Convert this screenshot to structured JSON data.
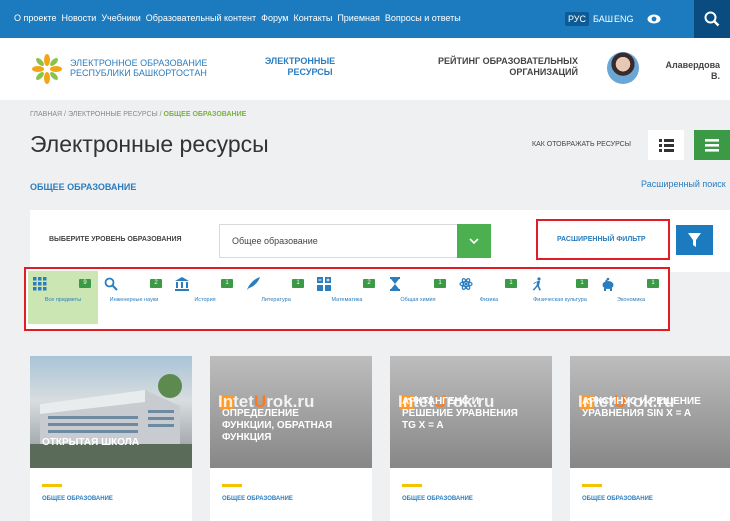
{
  "topnav": {
    "links": [
      "О проекте",
      "Новости",
      "Учебники",
      "Образовательный контент",
      "Форум",
      "Контакты",
      "Приемная",
      "Вопросы и ответы"
    ],
    "languages": [
      "РУС",
      "БАШ",
      "ENG"
    ],
    "active_language": "РУС"
  },
  "header": {
    "logo_line1": "Электронное образование",
    "logo_line2": "Республики Башкортостан",
    "electronic_line1": "Электронные",
    "electronic_line2": "ресурсы",
    "rating_line1": "Рейтинг образовательных",
    "rating_line2": "организаций",
    "user_line1": "Алавердова",
    "user_line2": "В."
  },
  "breadcrumb": {
    "home": "Главная",
    "sep": " / ",
    "resources": "Электронные ресурсы",
    "current": "Общее образование"
  },
  "page": {
    "title": "Электронные ресурсы",
    "view_label": "Как отображать ресурсы",
    "section": "Общее образование",
    "advanced_search": "Расширенный поиск"
  },
  "filter": {
    "level_label": "Выберите уровень образования",
    "level_value": "Общее образование",
    "advanced_filter": "Расширенный фильтр"
  },
  "subjects": [
    {
      "label": "Все предметы",
      "count": "9",
      "icon": "grid-icon"
    },
    {
      "label": "Инженерные науки",
      "count": "2",
      "icon": "magnifier-icon"
    },
    {
      "label": "История",
      "count": "1",
      "icon": "museum-icon"
    },
    {
      "label": "Литература",
      "count": "1",
      "icon": "quill-icon"
    },
    {
      "label": "Математика",
      "count": "2",
      "icon": "calculator-icon"
    },
    {
      "label": "Общая химия",
      "count": "1",
      "icon": "hourglass-icon"
    },
    {
      "label": "Физика",
      "count": "1",
      "icon": "atom-icon"
    },
    {
      "label": "Физическая культура",
      "count": "1",
      "icon": "runner-icon"
    },
    {
      "label": "Экономика",
      "count": "1",
      "icon": "piggy-icon"
    }
  ],
  "cards": [
    {
      "title": "Открытая школа",
      "category": "Общее образование",
      "watermark": ""
    },
    {
      "title": "Определение функции, обратная функция",
      "category": "Общее образование",
      "watermark_pre": "Int",
      "watermark_mid": "et",
      "watermark_u": "U",
      "watermark_post": "rok.ru"
    },
    {
      "title": "Арктангенс и решение уравнения tg x = a",
      "category": "Общее образование",
      "watermark_pre": "Int",
      "watermark_mid": "et",
      "watermark_u": "U",
      "watermark_post": "rok.ru"
    },
    {
      "title": "Арксинус и решение уравнения sin x = a",
      "category": "Общее образование",
      "watermark_pre": "Int",
      "watermark_mid": "et",
      "watermark_u": "U",
      "watermark_post": "rok.ru"
    }
  ],
  "colors": {
    "topbar": "#1c7bbf",
    "accent_green": "#3c9a46",
    "highlight_red": "#e31b23",
    "link_blue": "#2a7dbf"
  }
}
